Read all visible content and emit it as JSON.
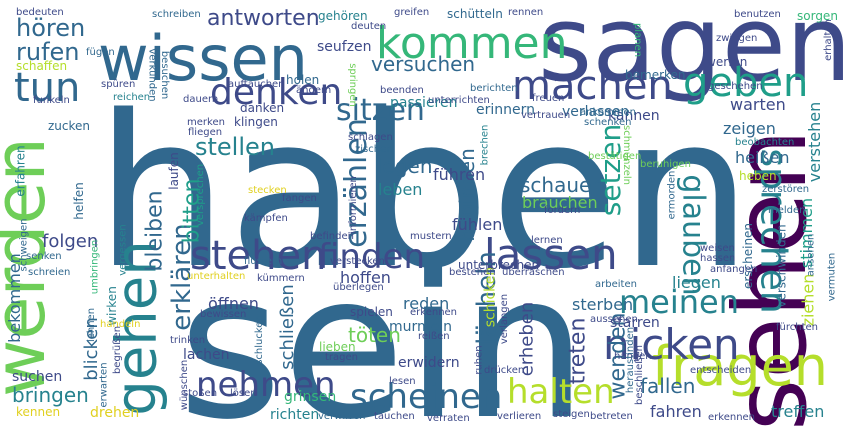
{
  "palette": {
    "dark_purple": "#440154",
    "indigo": "#3e4a89",
    "blue": "#31688e",
    "teal": "#26828e",
    "sea_green": "#1f9e89",
    "green": "#35b779",
    "light_green": "#6ece58",
    "lime": "#b5de2b",
    "yellow": "#e0d020"
  },
  "words": [
    {
      "text": "haben",
      "color": "#31688e"
    },
    {
      "text": "sein",
      "color": "#31688e"
    },
    {
      "text": "sagen",
      "color": "#3e4a89"
    },
    {
      "text": "werden",
      "color": "#6ece58"
    },
    {
      "text": "sehen",
      "color": "#440154"
    },
    {
      "text": "wissen",
      "color": "#31688e"
    },
    {
      "text": "gehen",
      "color": "#26828e"
    },
    {
      "text": "kommen",
      "color": "#35b779"
    },
    {
      "text": "fragen",
      "color": "#b5de2b"
    },
    {
      "text": "machen",
      "color": "#3e4a89"
    },
    {
      "text": "stehen",
      "color": "#3e4a89"
    },
    {
      "text": "lassen",
      "color": "#3e4a89"
    },
    {
      "text": "nicken",
      "color": "#3e4a89"
    },
    {
      "text": "geben",
      "color": "#1f9e89"
    },
    {
      "text": "denken",
      "color": "#3e4a89"
    },
    {
      "text": "tun",
      "color": "#31688e"
    },
    {
      "text": "sprechen",
      "color": "#26828e"
    },
    {
      "text": "nehmen",
      "color": "#3e4a89"
    },
    {
      "text": "scheinen",
      "color": "#31688e"
    },
    {
      "text": "halten",
      "color": "#b5de2b"
    },
    {
      "text": "meinen",
      "color": "#26828e"
    },
    {
      "text": "finden",
      "color": "#3e4a89"
    },
    {
      "text": "sitzen",
      "color": "#31688e"
    },
    {
      "text": "erzählen",
      "color": "#31688e"
    },
    {
      "text": "glauben",
      "color": "#26828e"
    },
    {
      "text": "setzen",
      "color": "#1f9e89"
    },
    {
      "text": "lächeln",
      "color": "#31688e"
    },
    {
      "text": "antworten",
      "color": "#3e4a89"
    },
    {
      "text": "hören",
      "color": "#31688e"
    },
    {
      "text": "rufen",
      "color": "#31688e"
    },
    {
      "text": "versuchen",
      "color": "#31688e"
    },
    {
      "text": "stellen",
      "color": "#26828e"
    },
    {
      "text": "erklären",
      "color": "#31688e"
    },
    {
      "text": "wenden",
      "color": "#31688e"
    },
    {
      "text": "treten",
      "color": "#3e4a89"
    },
    {
      "text": "bitten",
      "color": "#1f9e89"
    },
    {
      "text": "bleiben",
      "color": "#31688e"
    },
    {
      "text": "legen",
      "color": "#31688e"
    },
    {
      "text": "beginnen",
      "color": "#31688e"
    },
    {
      "text": "schauen",
      "color": "#31688e"
    },
    {
      "text": "brauchen",
      "color": "#6ece58"
    },
    {
      "text": "erheben",
      "color": "#3e4a89"
    },
    {
      "text": "töten",
      "color": "#6ece58"
    },
    {
      "text": "schließen",
      "color": "#31688e"
    },
    {
      "text": "bringen",
      "color": "#26828e"
    },
    {
      "text": "fallen",
      "color": "#31688e"
    },
    {
      "text": "blicken",
      "color": "#31688e"
    },
    {
      "text": "folgen",
      "color": "#3e4a89"
    },
    {
      "text": "bekommen",
      "color": "#31688e"
    },
    {
      "text": "öffnen",
      "color": "#3e4a89"
    },
    {
      "text": "reden",
      "color": "#31688e"
    },
    {
      "text": "hoffen",
      "color": "#3e4a89"
    },
    {
      "text": "schicken",
      "color": "#b5de2b"
    },
    {
      "text": "fühlen",
      "color": "#3e4a89"
    },
    {
      "text": "leben",
      "color": "#26828e"
    },
    {
      "text": "führen",
      "color": "#3e4a89"
    },
    {
      "text": "warten",
      "color": "#3e4a89"
    },
    {
      "text": "zeigen",
      "color": "#31688e"
    },
    {
      "text": "heißen",
      "color": "#31688e"
    },
    {
      "text": "verstehen",
      "color": "#26828e"
    },
    {
      "text": "stimmen",
      "color": "#1f9e89"
    },
    {
      "text": "ziehen",
      "color": "#b5de2b"
    },
    {
      "text": "liegen",
      "color": "#26828e"
    },
    {
      "text": "sterben",
      "color": "#31688e"
    },
    {
      "text": "erwidern",
      "color": "#3e4a89"
    },
    {
      "text": "murmeln",
      "color": "#31688e"
    },
    {
      "text": "lachen",
      "color": "#3e4a89"
    },
    {
      "text": "fahren",
      "color": "#3e4a89"
    },
    {
      "text": "treffen",
      "color": "#26828e"
    },
    {
      "text": "richten",
      "color": "#26828e"
    },
    {
      "text": "grinsen",
      "color": "#35b779"
    },
    {
      "text": "suchen",
      "color": "#3e4a89"
    },
    {
      "text": "drehen",
      "color": "#e0d020"
    },
    {
      "text": "kennen",
      "color": "#e0d020"
    },
    {
      "text": "seufzen",
      "color": "#3e4a89"
    },
    {
      "text": "gehören",
      "color": "#26828e"
    },
    {
      "text": "schaffen",
      "color": "#b5de2b"
    },
    {
      "text": "holen",
      "color": "#31688e"
    },
    {
      "text": "danken",
      "color": "#3e4a89"
    },
    {
      "text": "kannen",
      "color": "#3e4a89"
    },
    {
      "text": "passieren",
      "color": "#26828e"
    },
    {
      "text": "erinnern",
      "color": "#31688e"
    },
    {
      "text": "verlassen",
      "color": "#31688e"
    },
    {
      "text": "bemerken",
      "color": "#31688e"
    },
    {
      "text": "werfen",
      "color": "#3e4a89"
    },
    {
      "text": "sorgen",
      "color": "#35b779"
    },
    {
      "text": "laufen",
      "color": "#3e4a89"
    },
    {
      "text": "wirken",
      "color": "#26828e"
    },
    {
      "text": "erfahren",
      "color": "#26828e"
    },
    {
      "text": "helfen",
      "color": "#31688e"
    },
    {
      "text": "zucken",
      "color": "#31688e"
    },
    {
      "text": "heben",
      "color": "#b5de2b"
    },
    {
      "text": "klingen",
      "color": "#3e4a89"
    },
    {
      "text": "schütteln",
      "color": "#31688e"
    },
    {
      "text": "kämpfen",
      "color": "#3e4a89"
    },
    {
      "text": "fangen",
      "color": "#3e4a89"
    },
    {
      "text": "erwarten",
      "color": "#31688e"
    },
    {
      "text": "lehnen",
      "color": "#31688e"
    },
    {
      "text": "flüstern",
      "color": "#31688e"
    },
    {
      "text": "unterbrechen",
      "color": "#3e4a89"
    },
    {
      "text": "erscheinen",
      "color": "#31688e"
    },
    {
      "text": "verschwinden",
      "color": "#31688e"
    },
    {
      "text": "schlagen",
      "color": "#3e4a89"
    },
    {
      "text": "zischen",
      "color": "#31688e"
    },
    {
      "text": "brechen",
      "color": "#26828e"
    },
    {
      "text": "schenken",
      "color": "#31688e"
    },
    {
      "text": "ankommen",
      "color": "#31688e"
    },
    {
      "text": "freuen",
      "color": "#3e4a89"
    },
    {
      "text": "vertrauen",
      "color": "#3e4a89"
    },
    {
      "text": "reichen",
      "color": "#26828e"
    },
    {
      "text": "spüren",
      "color": "#3e4a89"
    },
    {
      "text": "funkeln",
      "color": "#3e4a89"
    },
    {
      "text": "fügen",
      "color": "#31688e"
    },
    {
      "text": "bedeuten",
      "color": "#3e4a89"
    },
    {
      "text": "schreiben",
      "color": "#31688e"
    },
    {
      "text": "greifen",
      "color": "#3e4a89"
    },
    {
      "text": "rennen",
      "color": "#3e4a89"
    },
    {
      "text": "benutzen",
      "color": "#3e4a89"
    },
    {
      "text": "deuten",
      "color": "#3e4a89"
    },
    {
      "text": "berichten",
      "color": "#31688e"
    },
    {
      "text": "besuchen",
      "color": "#31688e"
    },
    {
      "text": "verkünden",
      "color": "#31688e"
    },
    {
      "text": "dauern",
      "color": "#3e4a89"
    },
    {
      "text": "auftauchen",
      "color": "#3e4a89"
    },
    {
      "text": "ändern",
      "color": "#3e4a89"
    },
    {
      "text": "beenden",
      "color": "#3e4a89"
    },
    {
      "text": "unterrichten",
      "color": "#3e4a89"
    },
    {
      "text": "planen",
      "color": "#35b779"
    },
    {
      "text": "zwingen",
      "color": "#3e4a89"
    },
    {
      "text": "erhalten",
      "color": "#3e4a89"
    },
    {
      "text": "nennen",
      "color": "#3e4a89"
    },
    {
      "text": "geschehen",
      "color": "#3e4a89"
    },
    {
      "text": "springen",
      "color": "#6ece58"
    },
    {
      "text": "merken",
      "color": "#3e4a89"
    },
    {
      "text": "fliegen",
      "color": "#3e4a89"
    },
    {
      "text": "schmunzeln",
      "color": "#6ece58"
    },
    {
      "text": "bestätigen",
      "color": "#6ece58"
    },
    {
      "text": "beobachten",
      "color": "#26828e"
    },
    {
      "text": "ermorden",
      "color": "#31688e"
    },
    {
      "text": "beruhigen",
      "color": "#6ece58"
    },
    {
      "text": "zerstören",
      "color": "#31688e"
    },
    {
      "text": "informieren",
      "color": "#3e4a89"
    },
    {
      "text": "fordern",
      "color": "#3e4a89"
    },
    {
      "text": "stecken",
      "color": "#e0d020"
    },
    {
      "text": "versprechen",
      "color": "#1f9e89"
    },
    {
      "text": "schweigen",
      "color": "#31688e"
    },
    {
      "text": "senken",
      "color": "#31688e"
    },
    {
      "text": "schreien",
      "color": "#31688e"
    },
    {
      "text": "umbringen",
      "color": "#35b779"
    },
    {
      "text": "vergessen",
      "color": "#26828e"
    },
    {
      "text": "unterhalten",
      "color": "#e0d020"
    },
    {
      "text": "kümmern",
      "color": "#3e4a89"
    },
    {
      "text": "verstecken",
      "color": "#3e4a89"
    },
    {
      "text": "befinden",
      "color": "#3e4a89"
    },
    {
      "text": "mustern",
      "color": "#3e4a89"
    },
    {
      "text": "lernen",
      "color": "#3e4a89"
    },
    {
      "text": "weisen",
      "color": "#3e4a89"
    },
    {
      "text": "hassen",
      "color": "#3e4a89"
    },
    {
      "text": "anfangen",
      "color": "#3e4a89"
    },
    {
      "text": "ansehen",
      "color": "#31688e"
    },
    {
      "text": "vermuten",
      "color": "#31688e"
    },
    {
      "text": "melden",
      "color": "#31688e"
    },
    {
      "text": "bestehen",
      "color": "#3e4a89"
    },
    {
      "text": "überlegen",
      "color": "#3e4a89"
    },
    {
      "text": "überraschen",
      "color": "#3e4a89"
    },
    {
      "text": "arbeiten",
      "color": "#31688e"
    },
    {
      "text": "spielen",
      "color": "#3e4a89"
    },
    {
      "text": "erkennen",
      "color": "#3e4a89"
    },
    {
      "text": "bewissen",
      "color": "#3e4a89"
    },
    {
      "text": "handeln",
      "color": "#e0d020"
    },
    {
      "text": "verlangen",
      "color": "#3e4a89"
    },
    {
      "text": "aussehen",
      "color": "#3e4a89"
    },
    {
      "text": "starren",
      "color": "#3e4a89"
    },
    {
      "text": "fürchten",
      "color": "#3e4a89"
    },
    {
      "text": "reißen",
      "color": "#3e4a89"
    },
    {
      "text": "ruhen",
      "color": "#3e4a89"
    },
    {
      "text": "trinken",
      "color": "#3e4a89"
    },
    {
      "text": "schlucken",
      "color": "#31688e"
    },
    {
      "text": "lieben",
      "color": "#6ece58"
    },
    {
      "text": "tragen",
      "color": "#3e4a89"
    },
    {
      "text": "hängen",
      "color": "#3e4a89"
    },
    {
      "text": "drücken",
      "color": "#3e4a89"
    },
    {
      "text": "heraustinden",
      "color": "#31688e"
    },
    {
      "text": "beschließen",
      "color": "#3e4a89"
    },
    {
      "text": "entscheiden",
      "color": "#3e4a89"
    },
    {
      "text": "begrüßen",
      "color": "#3e4a89"
    },
    {
      "text": "lesen",
      "color": "#3e4a89"
    },
    {
      "text": "stoßen",
      "color": "#3e4a89"
    },
    {
      "text": "lösen",
      "color": "#3e4a89"
    },
    {
      "text": "wünschen",
      "color": "#3e4a89"
    },
    {
      "text": "verwirren",
      "color": "#31688e"
    },
    {
      "text": "tauchen",
      "color": "#3e4a89"
    },
    {
      "text": "verraten",
      "color": "#3e4a89"
    },
    {
      "text": "verlieren",
      "color": "#3e4a89"
    },
    {
      "text": "steigen",
      "color": "#3e4a89"
    },
    {
      "text": "betreten",
      "color": "#3e4a89"
    },
    {
      "text": "erkennen",
      "color": "#3e4a89"
    }
  ]
}
